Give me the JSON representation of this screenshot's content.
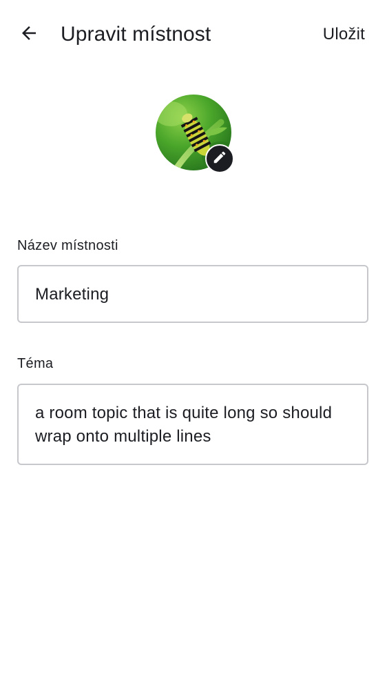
{
  "header": {
    "back_icon": "arrow-back-icon",
    "title": "Upravit místnost",
    "save_label": "Uložit"
  },
  "avatar": {
    "image": "caterpillar-photo",
    "edit_icon": "pencil-icon"
  },
  "form": {
    "name": {
      "label": "Název místnosti",
      "value": "Marketing"
    },
    "topic": {
      "label": "Téma",
      "value": "a room topic that is quite long so should wrap onto multiple lines"
    }
  },
  "colors": {
    "text": "#1b1d22",
    "border": "#c6c8cc",
    "background": "#ffffff"
  }
}
